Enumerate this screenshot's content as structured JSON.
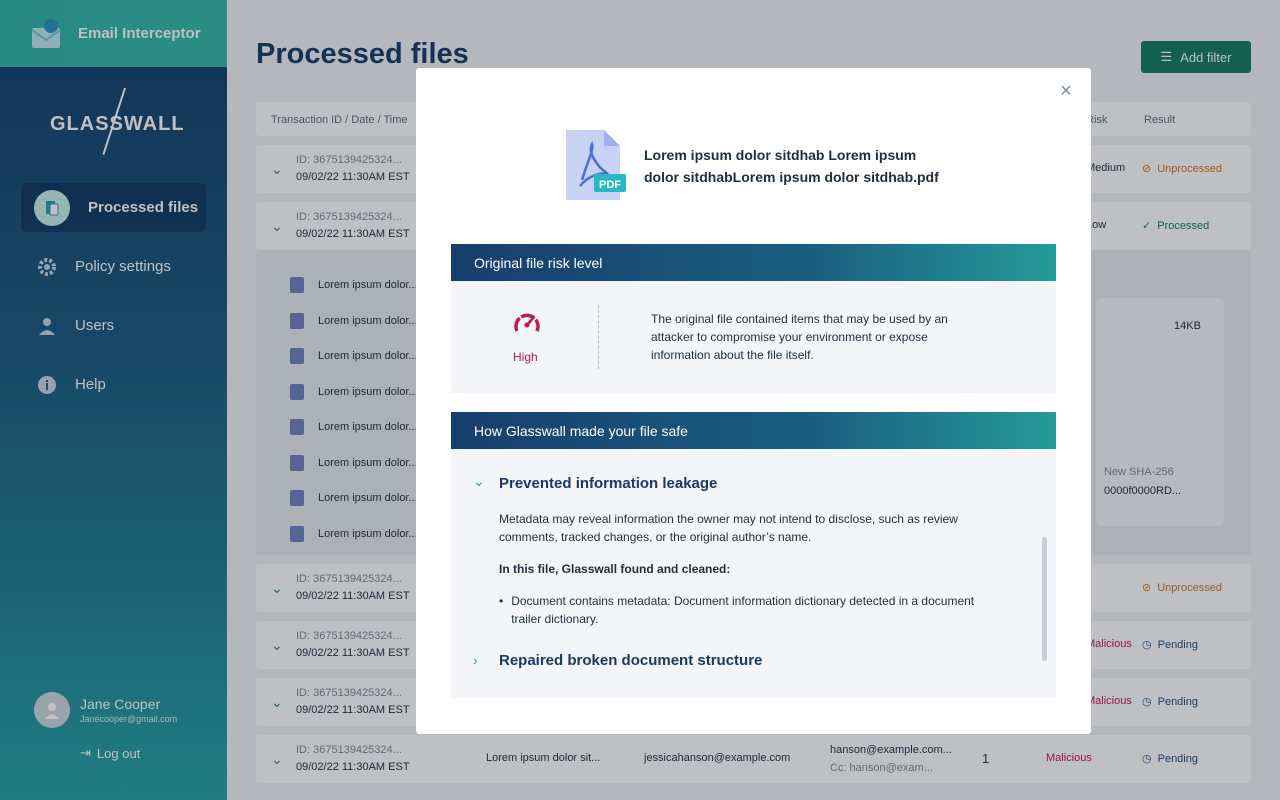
{
  "app": {
    "title": "Email Interceptor",
    "brand": "GLASSWALL"
  },
  "sidebar": {
    "items": [
      {
        "label": "Processed files",
        "icon": "processed-files-icon",
        "active": true
      },
      {
        "label": "Policy settings",
        "icon": "gear-icon"
      },
      {
        "label": "Users",
        "icon": "user-icon"
      },
      {
        "label": "Help",
        "icon": "info-icon"
      }
    ],
    "user": {
      "name": "Jane Cooper",
      "email": "Janecooper@gmail.com"
    },
    "logout": "Log out"
  },
  "header": {
    "title": "Processed files",
    "add_filter": "Add filter"
  },
  "table": {
    "columns": {
      "transaction": "Transaction ID / Date / Time",
      "risk": "Risk",
      "result": "Result"
    },
    "rows": [
      {
        "id": "ID: 3675139425324...",
        "date": "09/02/22 11:30AM EST",
        "risk": "Medium",
        "result": "Unprocessed"
      },
      {
        "id": "ID: 3675139425324...",
        "date": "09/02/22 11:30AM EST",
        "risk": "Low",
        "result": "Processed"
      },
      {
        "id": "ID: 3675139425324...",
        "date": "09/02/22 11:30AM EST",
        "risk": "",
        "result": "Unprocessed"
      },
      {
        "id": "ID: 3675139425324...",
        "date": "09/02/22 11:30AM EST",
        "risk": "Malicious",
        "result": "Pending"
      },
      {
        "id": "ID: 3675139425324...",
        "date": "09/02/22 11:30AM EST",
        "risk": "Malicious",
        "result": "Pending"
      },
      {
        "id": "ID: 3675139425324...",
        "date": "09/02/22 11:30AM EST",
        "subject": "Lorem ipsum dolor sit...",
        "sender": "jessicahanson@example.com",
        "recipient": "hanson@example.com...",
        "cc": "Cc: hanson@exam...",
        "count": "1",
        "risk": "Malicious",
        "result": "Pending"
      }
    ],
    "expanded_files": [
      "Lorem ipsum dolor...",
      "Lorem ipsum dolor...",
      "Lorem ipsum dolor...",
      "Lorem ipsum dolor...",
      "Lorem ipsum dolor...",
      "Lorem ipsum dolor...",
      "Lorem ipsum dolor...",
      "Lorem ipsum dolor..."
    ],
    "detail": {
      "size": "14KB",
      "sha_label": "New SHA-256",
      "sha_value": "0000f0000RD..."
    }
  },
  "modal": {
    "file_name": "Lorem ipsum dolor sitdhab Lorem ipsum dolor sitdhabLorem ipsum dolor sitdhab.pdf",
    "pdf_badge": "PDF",
    "risk_section": {
      "title": "Original file risk level",
      "level": "High",
      "description": "The original file contained items that may be used by an attacker to compromise your environment or expose information about the file itself."
    },
    "safe_section": {
      "title": "How Glasswall made your file safe",
      "items": [
        {
          "title": "Prevented information leakage",
          "description": "Metadata may reveal information the owner may not intend to disclose, such as review comments, tracked changes, or the original author’s name.",
          "found_label": "In this file, Glasswall found and cleaned:",
          "bullets": [
            "Document contains metadata: Document information dictionary detected in a document trailer dictionary."
          ]
        },
        {
          "title": "Repaired broken document structure"
        }
      ]
    }
  },
  "colors": {
    "brand": "#127a62",
    "risk_high": "#c2194c",
    "heading": "#173a66"
  }
}
